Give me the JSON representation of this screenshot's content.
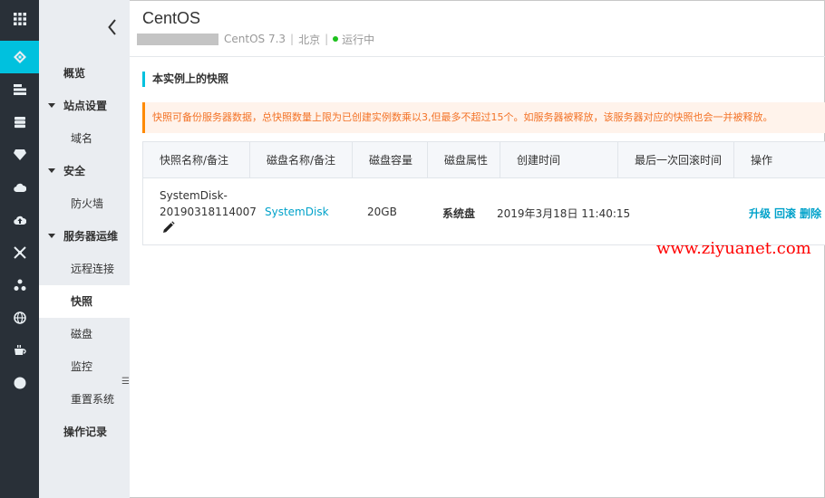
{
  "header": {
    "title": "CentOS",
    "os_version": "CentOS 7.3",
    "region": "北京",
    "status": "运行中",
    "status_color": "#1dc11d"
  },
  "sidebar": {
    "items": [
      {
        "label": "概览"
      },
      {
        "label": "站点设置"
      },
      {
        "label": "域名"
      },
      {
        "label": "安全"
      },
      {
        "label": "防火墙"
      },
      {
        "label": "服务器运维"
      },
      {
        "label": "远程连接"
      },
      {
        "label": "快照"
      },
      {
        "label": "磁盘"
      },
      {
        "label": "监控"
      },
      {
        "label": "重置系统"
      },
      {
        "label": "操作记录"
      }
    ],
    "active": "快照"
  },
  "rail": {
    "icons": [
      "grid-icon",
      "cube-icon",
      "server-stack-icon",
      "database-icon",
      "gem-icon",
      "cloud-icon",
      "cloud-upload-icon",
      "network-icon",
      "cluster-icon",
      "globe-icon",
      "cup-icon",
      "circle-icon"
    ],
    "active_index": 1,
    "accent_color": "#00c1de"
  },
  "section": {
    "title": "本实例上的快照"
  },
  "notice": {
    "text": "快照可备份服务器数据，总快照数量上限为已创建实例数乘以3,但最多不超过15个。如服务器被释放，该服务器对应的快照也会一并被释放。"
  },
  "table": {
    "columns": [
      "快照名称/备注",
      "磁盘名称/备注",
      "磁盘容量",
      "磁盘属性",
      "创建时间",
      "最后一次回滚时间",
      "操作"
    ],
    "rows": [
      {
        "snapshot_name_line1": "SystemDisk-",
        "snapshot_name_line2": "20190318114007",
        "disk_name": "SystemDisk",
        "capacity": "20GB",
        "attribute": "系统盘",
        "created": "2019年3月18日 11:40:15",
        "last_rollback": "",
        "actions": [
          "升级",
          "回滚",
          "删除"
        ]
      }
    ]
  },
  "watermark": "www.ziyuanet.com"
}
